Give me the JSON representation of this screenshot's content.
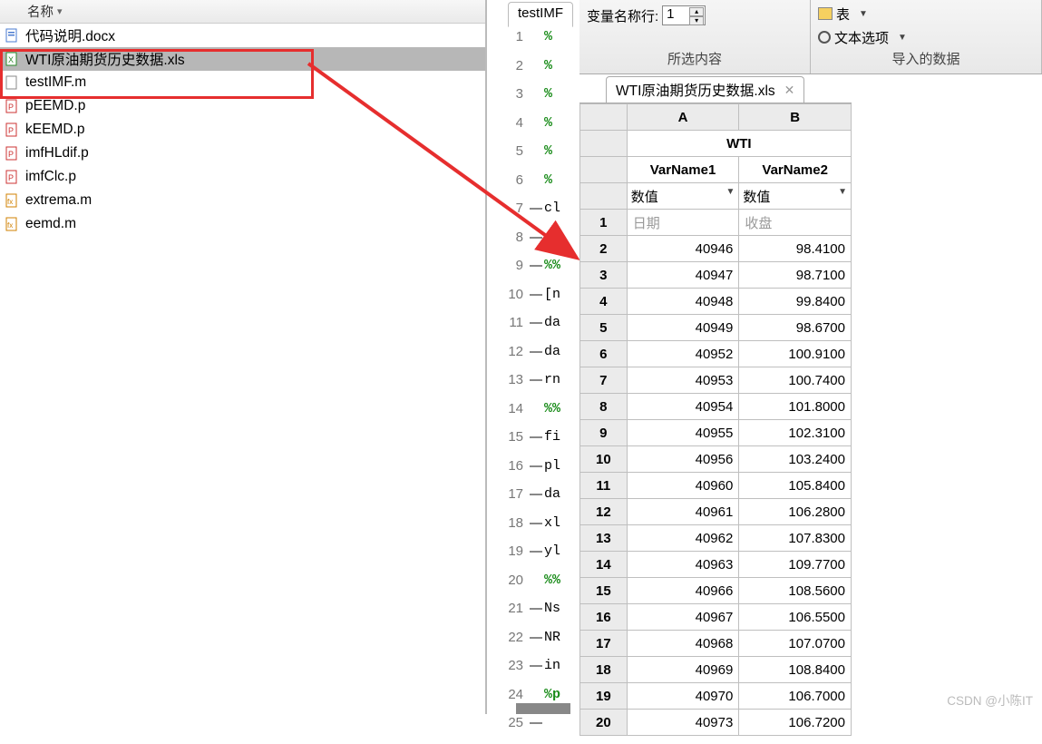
{
  "filebrowser": {
    "header": "名称",
    "items": [
      {
        "name": "代码说明.docx",
        "icon": "doc"
      },
      {
        "name": "WTI原油期货历史数据.xls",
        "icon": "xls",
        "selected": true
      },
      {
        "name": "testIMF.m",
        "icon": "m"
      },
      {
        "name": "pEEMD.p",
        "icon": "p"
      },
      {
        "name": "kEEMD.p",
        "icon": "p"
      },
      {
        "name": "imfHLdif.p",
        "icon": "p"
      },
      {
        "name": "imfClc.p",
        "icon": "p"
      },
      {
        "name": "extrema.m",
        "icon": "fx"
      },
      {
        "name": "eemd.m",
        "icon": "fx"
      }
    ]
  },
  "editor": {
    "tab": "testIMF",
    "lines": [
      {
        "n": "1",
        "t": "%",
        "cls": "pct"
      },
      {
        "n": "2",
        "t": "%",
        "cls": "pct"
      },
      {
        "n": "3",
        "t": "%",
        "cls": "pct"
      },
      {
        "n": "4",
        "t": "%",
        "cls": "pct"
      },
      {
        "n": "5",
        "t": "%",
        "cls": "pct"
      },
      {
        "n": "6",
        "t": "%",
        "cls": "pct"
      },
      {
        "n": "7",
        "t": "cl",
        "cls": "txt",
        "dash": true
      },
      {
        "n": "8",
        "t": "cl",
        "cls": "txt",
        "dash": true
      },
      {
        "n": "9",
        "t": "%%",
        "cls": "pct",
        "dash": true
      },
      {
        "n": "10",
        "t": "[n",
        "cls": "txt",
        "dash": true
      },
      {
        "n": "11",
        "t": "da",
        "cls": "txt",
        "dash": true
      },
      {
        "n": "12",
        "t": "da",
        "cls": "txt",
        "dash": true
      },
      {
        "n": "13",
        "t": "rn",
        "cls": "txt",
        "dash": true
      },
      {
        "n": "14",
        "t": "%%",
        "cls": "pct"
      },
      {
        "n": "15",
        "t": "fi",
        "cls": "txt",
        "dash": true
      },
      {
        "n": "16",
        "t": "pl",
        "cls": "txt",
        "dash": true
      },
      {
        "n": "17",
        "t": "da",
        "cls": "txt",
        "dash": true
      },
      {
        "n": "18",
        "t": "xl",
        "cls": "txt",
        "dash": true
      },
      {
        "n": "19",
        "t": "yl",
        "cls": "txt",
        "dash": true
      },
      {
        "n": "20",
        "t": "%%",
        "cls": "pct"
      },
      {
        "n": "21",
        "t": "Ns",
        "cls": "txt",
        "dash": true
      },
      {
        "n": "22",
        "t": "NR",
        "cls": "txt",
        "dash": true
      },
      {
        "n": "23",
        "t": "in",
        "cls": "txt",
        "dash": true
      },
      {
        "n": "24",
        "t": "%p",
        "cls": "pct"
      },
      {
        "n": "25",
        "t": "",
        "cls": "txt",
        "dash": true
      }
    ]
  },
  "toolbar": {
    "var_row_label": "变量名称行:",
    "var_row_value": "1",
    "table_label": "表",
    "text_options": "文本选项",
    "section1": "所选内容",
    "section2": "导入的数据"
  },
  "spreadsheet": {
    "tab": "WTI原油期货历史数据.xls",
    "cols": [
      "A",
      "B"
    ],
    "title_merged": "WTI",
    "varnames": [
      "VarName1",
      "VarName2"
    ],
    "types": [
      "数值",
      "数值"
    ],
    "rows": [
      {
        "n": "1",
        "a": "日期",
        "b": "收盘",
        "gray": true
      },
      {
        "n": "2",
        "a": "40946",
        "b": "98.4100"
      },
      {
        "n": "3",
        "a": "40947",
        "b": "98.7100"
      },
      {
        "n": "4",
        "a": "40948",
        "b": "99.8400"
      },
      {
        "n": "5",
        "a": "40949",
        "b": "98.6700"
      },
      {
        "n": "6",
        "a": "40952",
        "b": "100.9100"
      },
      {
        "n": "7",
        "a": "40953",
        "b": "100.7400"
      },
      {
        "n": "8",
        "a": "40954",
        "b": "101.8000"
      },
      {
        "n": "9",
        "a": "40955",
        "b": "102.3100"
      },
      {
        "n": "10",
        "a": "40956",
        "b": "103.2400"
      },
      {
        "n": "11",
        "a": "40960",
        "b": "105.8400"
      },
      {
        "n": "12",
        "a": "40961",
        "b": "106.2800"
      },
      {
        "n": "13",
        "a": "40962",
        "b": "107.8300"
      },
      {
        "n": "14",
        "a": "40963",
        "b": "109.7700"
      },
      {
        "n": "15",
        "a": "40966",
        "b": "108.5600"
      },
      {
        "n": "16",
        "a": "40967",
        "b": "106.5500"
      },
      {
        "n": "17",
        "a": "40968",
        "b": "107.0700"
      },
      {
        "n": "18",
        "a": "40969",
        "b": "108.8400"
      },
      {
        "n": "19",
        "a": "40970",
        "b": "106.7000"
      },
      {
        "n": "20",
        "a": "40973",
        "b": "106.7200"
      }
    ]
  },
  "watermark": "CSDN @小陈IT"
}
